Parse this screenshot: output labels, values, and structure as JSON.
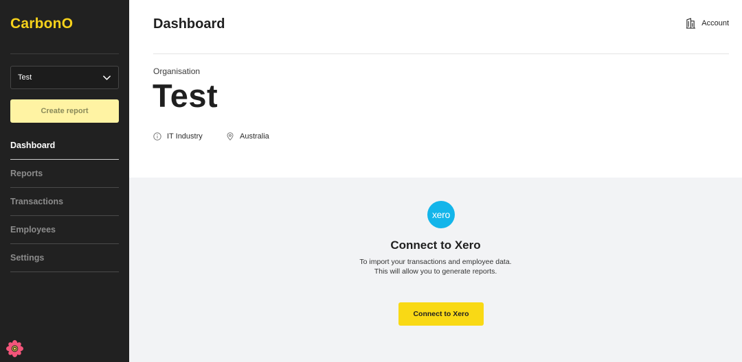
{
  "sidebar": {
    "logo": "CarbonO",
    "org_select": {
      "value": "Test"
    },
    "create_report": "Create report",
    "nav": [
      {
        "label": "Dashboard",
        "active": true
      },
      {
        "label": "Reports",
        "active": false
      },
      {
        "label": "Transactions",
        "active": false
      },
      {
        "label": "Employees",
        "active": false
      },
      {
        "label": "Settings",
        "active": false
      }
    ]
  },
  "header": {
    "title": "Dashboard",
    "account": "Account"
  },
  "organisation": {
    "label": "Organisation",
    "name": "Test",
    "industry": "IT Industry",
    "location": "Australia"
  },
  "connect": {
    "logo_text": "xero",
    "title": "Connect to Xero",
    "line1": "To import your transactions and employee data.",
    "line2": "This will allow you to generate reports.",
    "button": "Connect to Xero"
  },
  "colors": {
    "sidebar_bg": "#212121",
    "brand_yellow": "#f7d21b",
    "button_yellow": "#f9d915",
    "xero_blue": "#13b5ea",
    "panel_bg": "#f2f3f5"
  },
  "icons": [
    "chevron-down-icon",
    "building-icon",
    "info-icon",
    "location-pin-icon",
    "flower-icon"
  ]
}
